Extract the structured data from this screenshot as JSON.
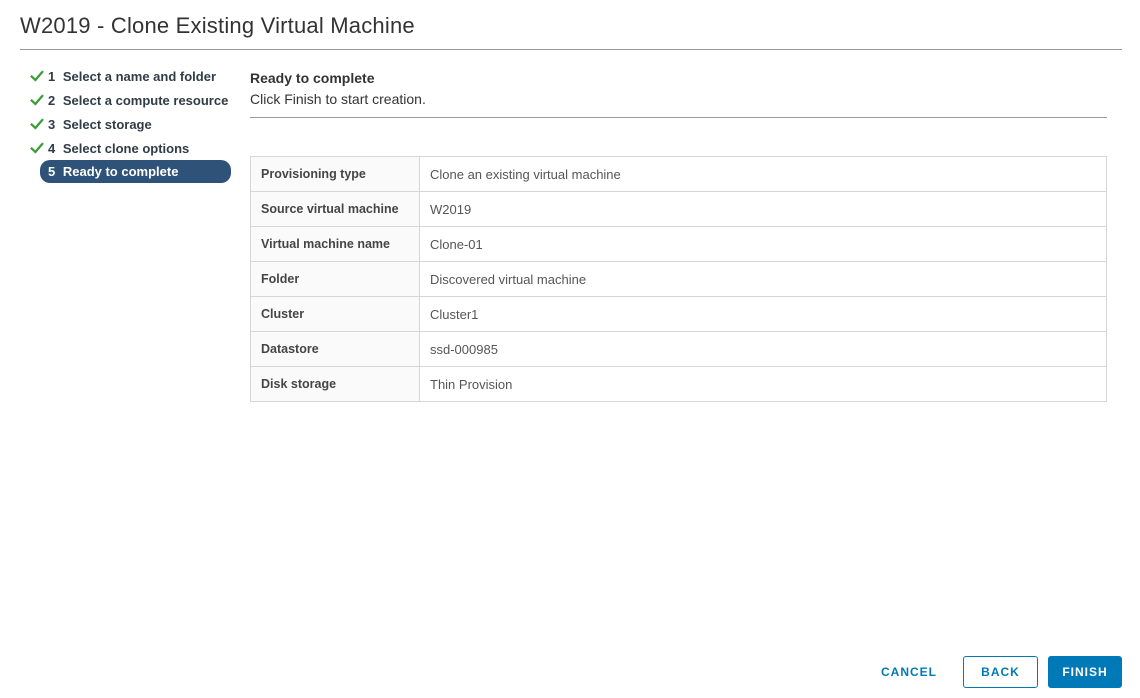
{
  "wizard": {
    "title": "W2019 - Clone Existing Virtual Machine"
  },
  "steps": [
    {
      "number": "1",
      "label": "Select a name and folder",
      "state": "completed"
    },
    {
      "number": "2",
      "label": "Select a compute resource",
      "state": "completed"
    },
    {
      "number": "3",
      "label": "Select storage",
      "state": "completed"
    },
    {
      "number": "4",
      "label": "Select clone options",
      "state": "completed"
    },
    {
      "number": "5",
      "label": "Ready to complete",
      "state": "current"
    }
  ],
  "panel": {
    "heading": "Ready to complete",
    "subheading": "Click Finish to start creation."
  },
  "summary_table": {
    "rows": [
      {
        "label": "Provisioning type",
        "value": "Clone an existing virtual machine"
      },
      {
        "label": "Source virtual machine",
        "value": "W2019"
      },
      {
        "label": "Virtual machine name",
        "value": "Clone-01"
      },
      {
        "label": "Folder",
        "value": "Discovered virtual machine"
      },
      {
        "label": "Cluster",
        "value": "Cluster1"
      },
      {
        "label": "Datastore",
        "value": "ssd-000985"
      },
      {
        "label": "Disk storage",
        "value": "Thin Provision"
      }
    ]
  },
  "footer": {
    "cancel_label": "CANCEL",
    "back_label": "BACK",
    "finish_label": "FINISH"
  },
  "icons": {
    "completed_step": "check-icon"
  },
  "colors": {
    "accent_blue": "#0079b8",
    "current_step_bg": "#2f5378",
    "check_green": "#3c9d38",
    "table_label_bg": "#fafafa"
  }
}
